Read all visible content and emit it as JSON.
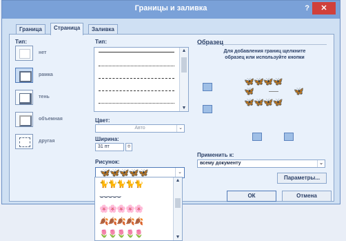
{
  "window": {
    "title": "Границы и заливка",
    "help": "?",
    "close": "✕"
  },
  "tabs": [
    {
      "label": "Граница",
      "active": false
    },
    {
      "label": "Страница",
      "active": true
    },
    {
      "label": "Заливка",
      "active": false
    }
  ],
  "type_section": {
    "label": "Тип:",
    "items": [
      {
        "label": "нет",
        "icon": "none-border-icon",
        "selected": false
      },
      {
        "label": "рамка",
        "icon": "box-border-icon",
        "selected": true
      },
      {
        "label": "тень",
        "icon": "shadow-border-icon",
        "selected": false
      },
      {
        "label": "объемная",
        "icon": "3d-border-icon",
        "selected": false
      },
      {
        "label": "другая",
        "icon": "custom-border-icon",
        "selected": false
      }
    ]
  },
  "style_section": {
    "label": "Тип:"
  },
  "color": {
    "label": "Цвет:",
    "value": "Авто"
  },
  "width": {
    "label": "Ширина:",
    "value": "31 пт"
  },
  "art": {
    "label": "Рисунок:",
    "selected": "🦋🦋🦋🦋🦋",
    "options": [
      "🐈🐈🐈🐈🐈",
      "⌣⌣⌣⌣⌣",
      "🌸🌸🌸🌸🌸",
      "🍂🍂🍂🍂🍂",
      "🌷🌷🌷🌷🌷"
    ]
  },
  "preview": {
    "label": "Образец",
    "hint": "Для добавления границ щелкните образец или используйте кнопки"
  },
  "apply_to": {
    "label": "Применить к:",
    "value": "всему документу"
  },
  "buttons": {
    "options": "Параметры...",
    "ok": "ОК",
    "cancel": "Отмена"
  },
  "colors": {
    "titlebar": "#7aa1d8",
    "close": "#d0403b",
    "panel": "#e9f1fb",
    "art": "#6a2a7a"
  }
}
